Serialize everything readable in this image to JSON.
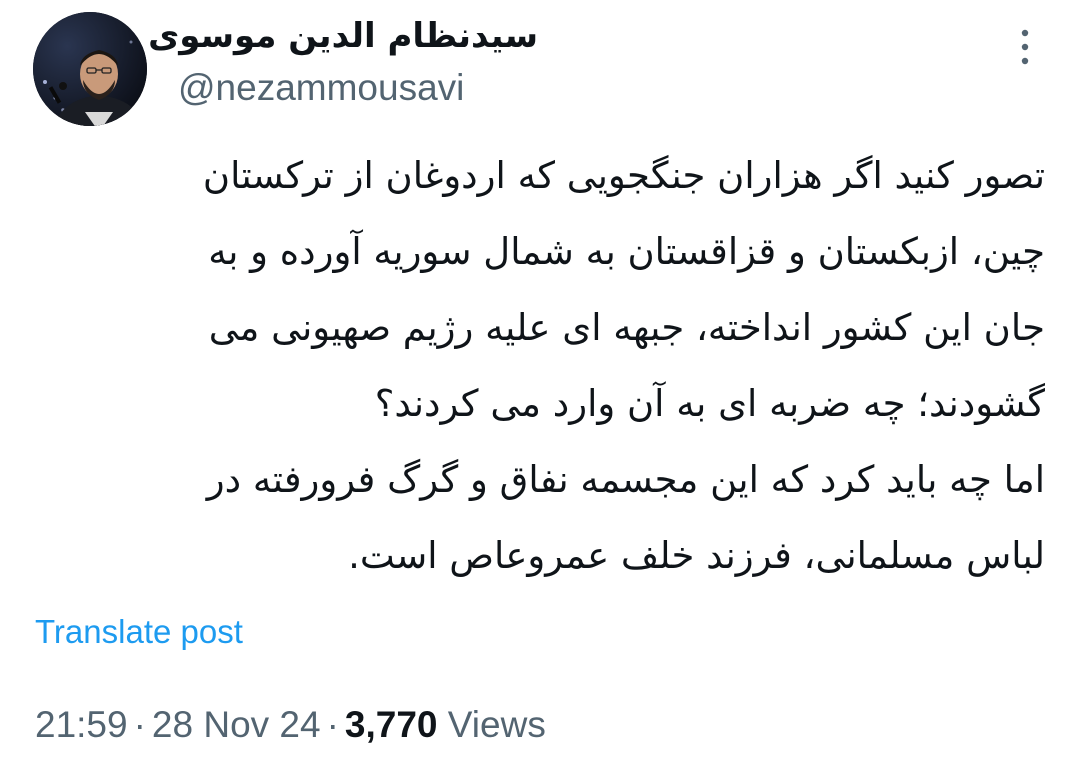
{
  "author": {
    "display_name": "سیدنظام الدین موسوی",
    "handle": "@nezammousavi",
    "avatar_icon": "profile-photo"
  },
  "post": {
    "lines": [
      "تصور کنید اگر هزاران جنگجویی که اردوغان از ترکستان",
      "چین، ازبکستان و قزاقستان به شمال سوریه آورده و به",
      "جان این کشور انداخته، جبهه ای علیه رژیم صهیونی می",
      "گشودند؛ چه ضربه ای به آن وارد می کردند؟",
      "اما چه باید کرد که این مجسمه نفاق و گرگ فرورفته در",
      "لباس مسلمانی، فرزند خلف عمروعاص است."
    ]
  },
  "actions": {
    "translate_label": "Translate post",
    "more_icon": "more-vertical-icon"
  },
  "meta": {
    "time": "21:59",
    "separator": "·",
    "date": "28 Nov 24",
    "views_count": "3,770",
    "views_label": "Views"
  },
  "colors": {
    "text_primary": "#0f1419",
    "text_secondary": "#536471",
    "link": "#1d9bf0",
    "background": "#ffffff"
  }
}
